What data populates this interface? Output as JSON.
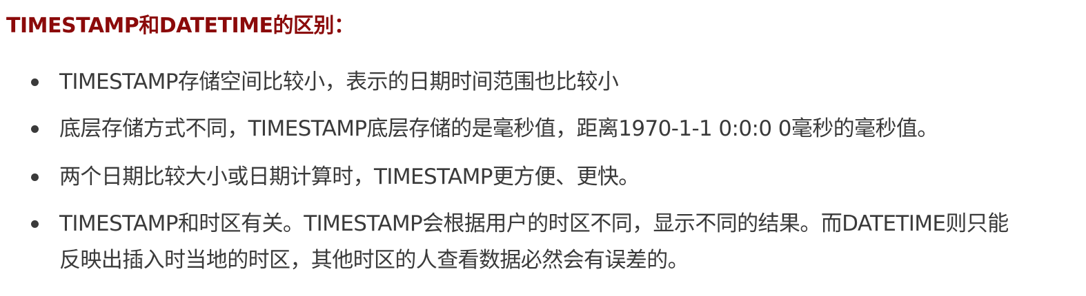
{
  "section": {
    "heading": "TIMESTAMP和DATETIME的区别：",
    "bullets": [
      {
        "lines": [
          "TIMESTAMP存储空间比较小，表示的日期时间范围也比较小"
        ]
      },
      {
        "lines": [
          "底层存储方式不同，TIMESTAMP底层存储的是毫秒值，距离1970-1-1 0:0:0 0毫秒的毫秒值。"
        ]
      },
      {
        "lines": [
          "两个日期比较大小或日期计算时，TIMESTAMP更方便、更快。"
        ]
      },
      {
        "lines": [
          "TIMESTAMP和时区有关。TIMESTAMP会根据用户的时区不同，显示不同的结果。而DATETIME则只能",
          "反映出插入时当地的时区，其他时区的人查看数据必然会有误差的。"
        ]
      }
    ]
  }
}
